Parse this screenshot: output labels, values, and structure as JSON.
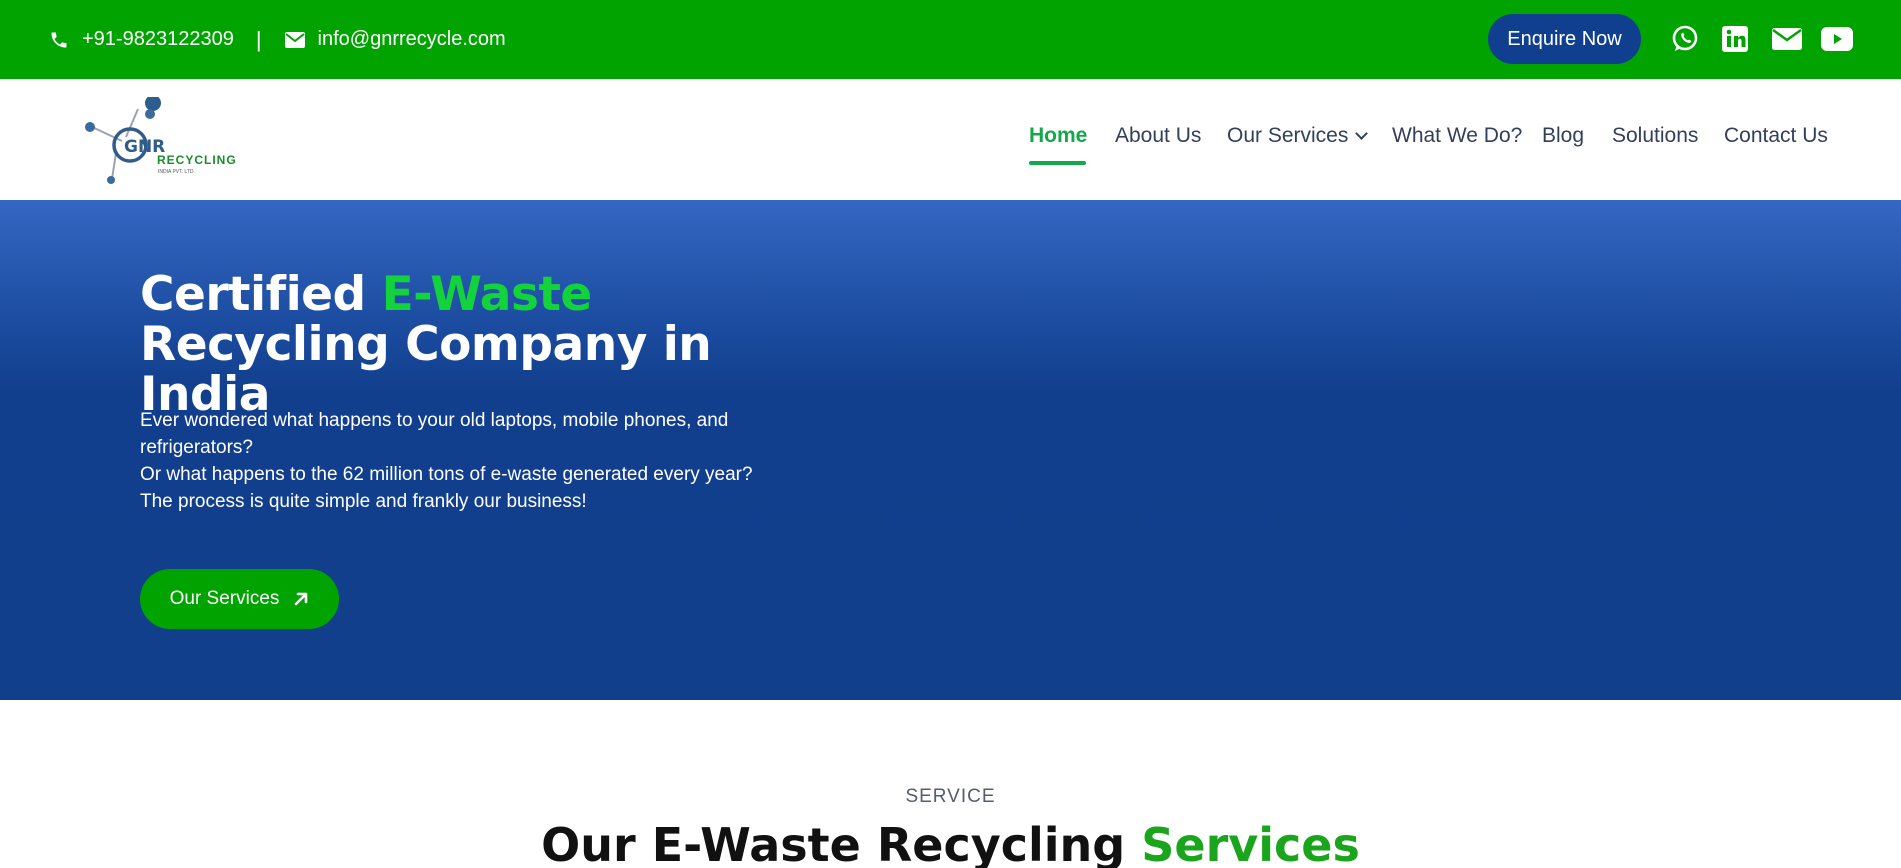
{
  "topbar": {
    "phone": "+91-9823122309",
    "separator": "|",
    "email": "info@gnrrecycle.com",
    "enquire_label": "Enquire Now",
    "social_icons": [
      "whatsapp-icon",
      "linkedin-icon",
      "mail-icon",
      "youtube-icon"
    ],
    "bg_color": "#00a300"
  },
  "logo": {
    "brand_mark": "GNR",
    "brand_word": "RECYCLING",
    "brand_sub": "INDIA PVT. LTD."
  },
  "nav": {
    "items": [
      {
        "label": "Home",
        "active": true
      },
      {
        "label": "About Us"
      },
      {
        "label": "Our Services",
        "has_dropdown": true
      },
      {
        "label": "What We Do?"
      },
      {
        "label": "Blog"
      },
      {
        "label": "Solutions"
      },
      {
        "label": "Contact Us"
      }
    ],
    "active_color": "#13a84a"
  },
  "hero": {
    "title_part1": "Certified ",
    "title_highlight": "E-Waste",
    "title_part2": " Recycling Company in India",
    "line1": "Ever wondered what happens to your old laptops, mobile phones, and refrigerators?",
    "line2": "Or what happens to the 62 million tons of e-waste generated every year?",
    "line3": "The process is quite simple and frankly our business!",
    "button_label": "Our Services",
    "bg_color": "#113f8c",
    "accent_color": "#14d23c"
  },
  "service_section": {
    "label": "SERVICE",
    "title_part1": "Our E-Waste Recycling ",
    "title_highlight": "Services"
  }
}
